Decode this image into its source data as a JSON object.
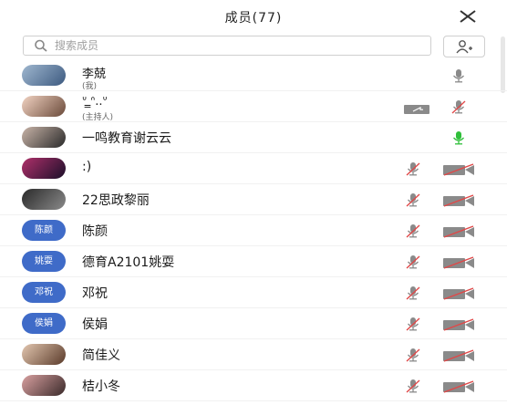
{
  "header": {
    "title": "成员(77)"
  },
  "search": {
    "placeholder": "搜索成员"
  },
  "members": [
    {
      "name": "李兢",
      "note": "(我)",
      "avatar": "photo",
      "mic": "idle",
      "video": "none"
    },
    {
      "name": "ᐡ ̳ᐢ..ᐡ",
      "note": "(主持人)",
      "avatar": "photo",
      "mic": "muted",
      "video": "screen-share"
    },
    {
      "name": "一鸣教育谢云云",
      "note": "",
      "avatar": "photo",
      "mic": "speaking",
      "video": "none"
    },
    {
      "name": ":)",
      "note": "",
      "avatar": "photo",
      "mic": "muted",
      "video": "off"
    },
    {
      "name": "22思政黎丽",
      "note": "",
      "avatar": "photo",
      "mic": "muted",
      "video": "off"
    },
    {
      "name": "陈颜",
      "note": "",
      "avatar": "text",
      "avatar_text": "陈颜",
      "mic": "muted",
      "video": "off"
    },
    {
      "name": "德育A2101姚耍",
      "note": "",
      "avatar": "text",
      "avatar_text": "姚耍",
      "mic": "muted",
      "video": "off"
    },
    {
      "name": "邓祝",
      "note": "",
      "avatar": "text",
      "avatar_text": "邓祝",
      "mic": "muted",
      "video": "off"
    },
    {
      "name": "侯娟",
      "note": "",
      "avatar": "text",
      "avatar_text": "侯娟",
      "mic": "muted",
      "video": "off"
    },
    {
      "name": "简佳义",
      "note": "",
      "avatar": "photo",
      "mic": "muted",
      "video": "off"
    },
    {
      "name": "桔小冬",
      "note": "",
      "avatar": "photo",
      "mic": "muted",
      "video": "off"
    }
  ],
  "colors": {
    "text_avatar_bg": "#3f6bc8",
    "speaking": "#2fbf3a",
    "muted_slash": "#e04848",
    "icon_gray": "#8a8a8a"
  }
}
